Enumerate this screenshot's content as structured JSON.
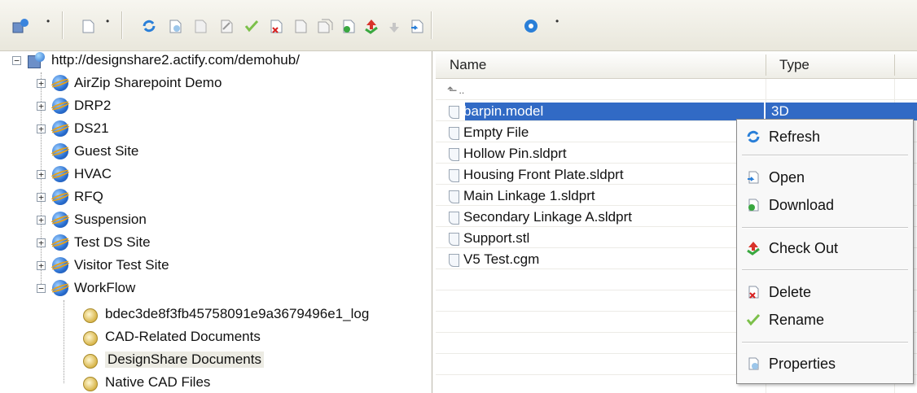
{
  "colors": {
    "selection": "#316ac5",
    "toolbar_bg": "#ece9d8"
  },
  "toolbar": {
    "buttons": [
      {
        "icon": "connect-icon"
      },
      {
        "icon": "new-document-icon"
      },
      {
        "icon": "refresh-icon"
      },
      {
        "icon": "properties-icon"
      },
      {
        "icon": "view-icon"
      },
      {
        "icon": "comment-icon"
      },
      {
        "icon": "rename-icon"
      },
      {
        "icon": "delete-icon"
      },
      {
        "icon": "lock-icon"
      },
      {
        "icon": "copy-icon"
      },
      {
        "icon": "download-icon"
      },
      {
        "icon": "check-out-icon"
      },
      {
        "icon": "check-in-icon"
      },
      {
        "icon": "open-icon"
      },
      {
        "icon": "help-icon"
      }
    ]
  },
  "tree": {
    "root": "http://designshare2.actify.com/demohub/",
    "sites": [
      {
        "label": "AirZip Sharepoint Demo",
        "expander": "+"
      },
      {
        "label": "DRP2",
        "expander": "+"
      },
      {
        "label": "DS21",
        "expander": "+"
      },
      {
        "label": "Guest Site",
        "expander": ""
      },
      {
        "label": "HVAC",
        "expander": "+"
      },
      {
        "label": "RFQ",
        "expander": "+"
      },
      {
        "label": "Suspension",
        "expander": "+"
      },
      {
        "label": "Test DS Site",
        "expander": "+"
      },
      {
        "label": "Visitor Test Site",
        "expander": "+"
      },
      {
        "label": "WorkFlow",
        "expander": "−"
      }
    ],
    "workflow_children": [
      {
        "label": "bdec3de8f3fb45758091e9a3679496e1_log"
      },
      {
        "label": "CAD-Related Documents"
      },
      {
        "label": "DesignShare Documents"
      },
      {
        "label": "Native CAD Files"
      }
    ]
  },
  "list": {
    "columns": [
      "Name",
      "Type"
    ],
    "parent": "..",
    "files": [
      {
        "name": "barpin.model",
        "type": "3D"
      },
      {
        "name": "Empty File",
        "type": ""
      },
      {
        "name": "Hollow Pin.sldprt",
        "type": ""
      },
      {
        "name": "Housing Front Plate.sldprt",
        "type": ""
      },
      {
        "name": "Main Linkage 1.sldprt",
        "type": ""
      },
      {
        "name": "Secondary Linkage A.sldprt",
        "type": ""
      },
      {
        "name": "Support.stl",
        "type": ""
      },
      {
        "name": "V5 Test.cgm",
        "type": ""
      }
    ]
  },
  "context_menu": {
    "items": [
      {
        "label": "Refresh",
        "icon": "refresh-icon"
      },
      {
        "label": "Open",
        "icon": "open-icon"
      },
      {
        "label": "Download",
        "icon": "download-icon"
      },
      {
        "label": "Check Out",
        "icon": "check-out-icon"
      },
      {
        "label": "Delete",
        "icon": "delete-icon"
      },
      {
        "label": "Rename",
        "icon": "rename-icon"
      },
      {
        "label": "Properties",
        "icon": "properties-icon"
      }
    ]
  }
}
